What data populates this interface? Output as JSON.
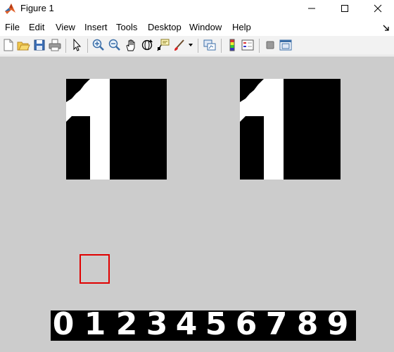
{
  "window": {
    "title": "Figure 1",
    "icon": "matlab-logo-icon",
    "controls": [
      "minimize-icon",
      "maximize-icon",
      "close-icon"
    ]
  },
  "menu": {
    "items": [
      "File",
      "Edit",
      "View",
      "Insert",
      "Tools",
      "Desktop",
      "Window",
      "Help"
    ]
  },
  "toolbar": {
    "buttons": [
      "new-figure-icon",
      "open-file-icon",
      "save-icon",
      "print-icon",
      "pointer-icon",
      "zoom-in-icon",
      "zoom-out-icon",
      "pan-icon",
      "rotate-3d-icon",
      "data-cursor-icon",
      "brush-icon",
      "link-plot-icon",
      "colorbar-icon",
      "legend-icon",
      "hide-plot-tools-icon",
      "show-plot-tools-icon"
    ]
  },
  "figure": {
    "panels": [
      {
        "name": "left-digit-image",
        "depicts": "1"
      },
      {
        "name": "right-digit-image",
        "depicts": "1"
      }
    ],
    "digit_strip": [
      "0",
      "1",
      "2",
      "3",
      "4",
      "5",
      "6",
      "7",
      "8",
      "9"
    ],
    "selected_digit_index": 1,
    "colors": {
      "background": "#cccccc",
      "image": "#000000",
      "glyph": "#ffffff",
      "selection": "#e00000"
    }
  }
}
